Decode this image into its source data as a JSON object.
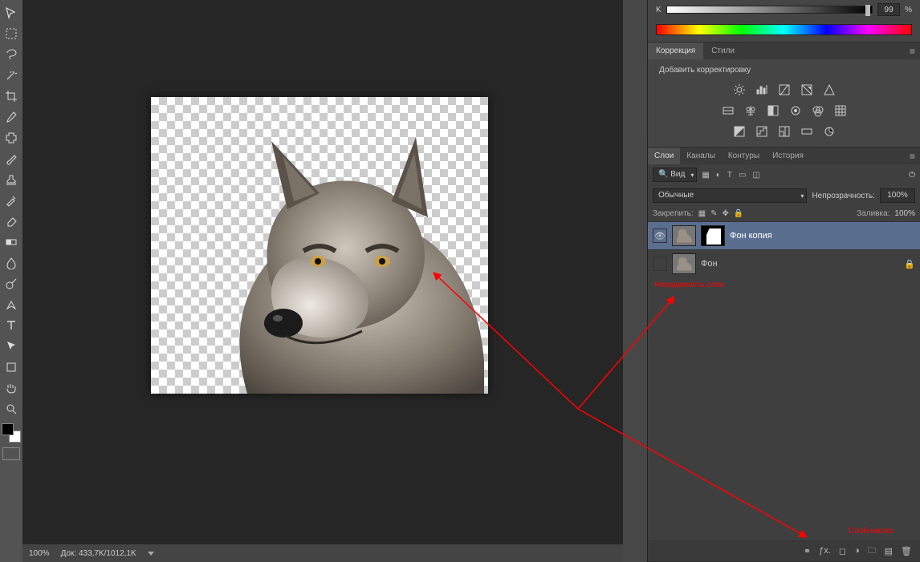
{
  "color": {
    "channel": "K",
    "value": "99",
    "percent": "%"
  },
  "adjustments": {
    "tab1": "Коррекция",
    "tab2": "Стили",
    "add_label": "Добавить корректировку"
  },
  "layers": {
    "tabs": {
      "layers": "Слои",
      "channels": "Каналы",
      "paths": "Контуры",
      "history": "История"
    },
    "filter": {
      "label": "Вид"
    },
    "blend_mode": "Обычные",
    "opacity_label": "Непрозрачность:",
    "opacity_value": "100%",
    "lock_label": "Закрепить:",
    "fill_label": "Заливка:",
    "fill_value": "100%",
    "items": [
      {
        "name": "Фон копия",
        "visible": true,
        "has_mask": true,
        "locked": false
      },
      {
        "name": "Фон",
        "visible": false,
        "has_mask": false,
        "locked": true
      }
    ]
  },
  "annotations": {
    "visibility": "Невидимость слоя",
    "mask": "Слой-маска"
  },
  "status": {
    "zoom": "100%",
    "docinfo": "Док: 433,7K/1012,1K"
  },
  "image_subject": "wolf"
}
